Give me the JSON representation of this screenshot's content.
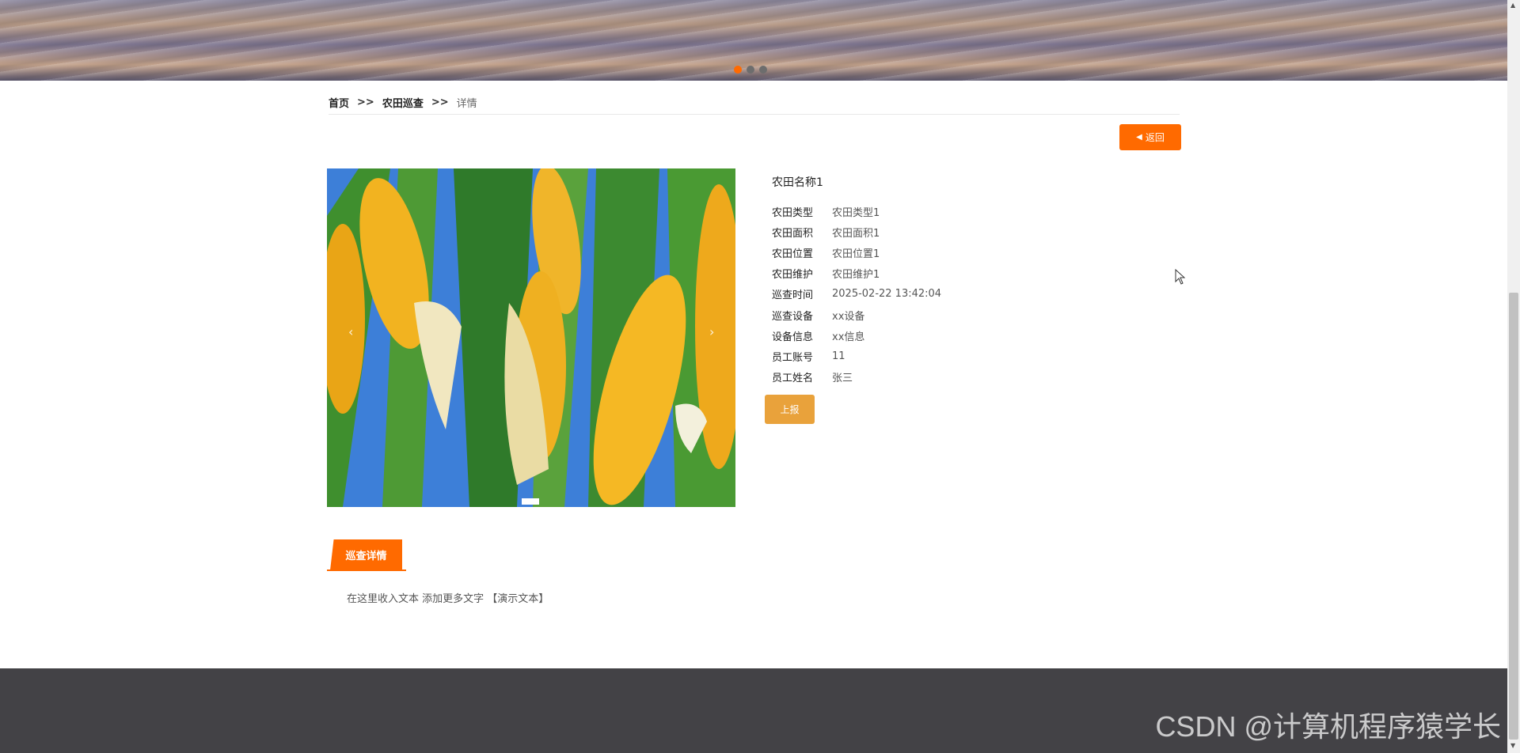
{
  "breadcrumb": {
    "home": "首页",
    "sep1": ">>",
    "section": "农田巡查",
    "sep2": ">>",
    "current": "详情"
  },
  "back_button": {
    "label": "返回"
  },
  "detail": {
    "title": "农田名称1",
    "rows": [
      {
        "label": "农田类型",
        "value": "农田类型1"
      },
      {
        "label": "农田面积",
        "value": "农田面积1"
      },
      {
        "label": "农田位置",
        "value": "农田位置1"
      },
      {
        "label": "农田维护",
        "value": "农田维护1"
      },
      {
        "label": "巡查时间",
        "value": "2025-02-22 13:42:04"
      },
      {
        "label": "巡查设备",
        "value": "xx设备"
      },
      {
        "label": "设备信息",
        "value": "xx信息"
      },
      {
        "label": "员工账号",
        "value": "11"
      },
      {
        "label": "员工姓名",
        "value": "张三"
      }
    ]
  },
  "report_button": {
    "label": "上报"
  },
  "tab": {
    "label": "巡查详情"
  },
  "description": "在这里收入文本 添加更多文字 【演示文本】",
  "watermark": "CSDN @计算机程序猿学长",
  "colors": {
    "accent": "#ff6a00",
    "report": "#e9a23b",
    "footer": "#434246"
  }
}
